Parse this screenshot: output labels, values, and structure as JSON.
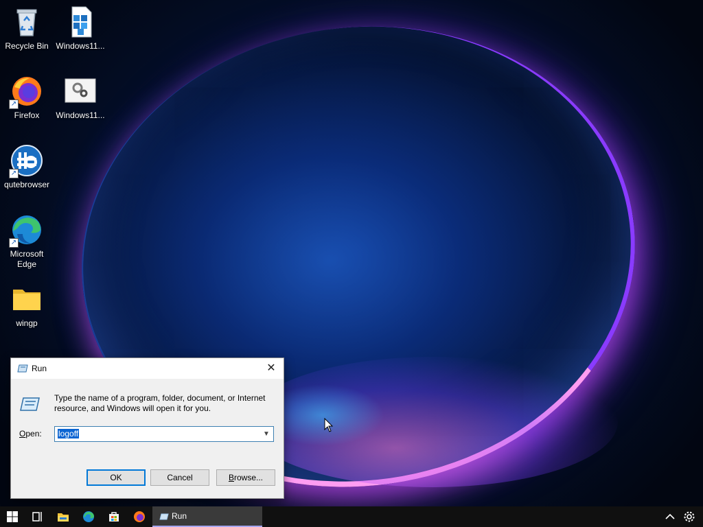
{
  "desktop": {
    "icons": [
      {
        "label": "Recycle Bin",
        "icon": "recycle-bin-icon"
      },
      {
        "label": "Windows11...",
        "icon": "installer-package-icon"
      },
      {
        "label": "Firefox",
        "icon": "firefox-icon"
      },
      {
        "label": "Windows11...",
        "icon": "settings-file-icon"
      },
      {
        "label": "qutebrowser",
        "icon": "qutebrowser-icon"
      },
      {
        "label": "Microsoft Edge",
        "icon": "edge-icon"
      },
      {
        "label": "wingp",
        "icon": "folder-icon"
      }
    ]
  },
  "run_dialog": {
    "title": "Run",
    "close_glyph": "✕",
    "description": "Type the name of a program, folder, document, or Internet resource, and Windows will open it for you.",
    "open_label_prefix": "",
    "open_label_access": "O",
    "open_label_rest": "pen:",
    "open_value": "logoff",
    "ok_label": "OK",
    "cancel_label": "Cancel",
    "browse_access": "B",
    "browse_rest": "rowse..."
  },
  "taskbar": {
    "buttons": [
      "start-icon",
      "task-view-icon",
      "file-explorer-icon",
      "edge-icon",
      "store-icon",
      "firefox-icon"
    ],
    "active_window_label": "Run",
    "tray": [
      "show-hidden-icons-chevron",
      "settings-gear-icon"
    ]
  }
}
